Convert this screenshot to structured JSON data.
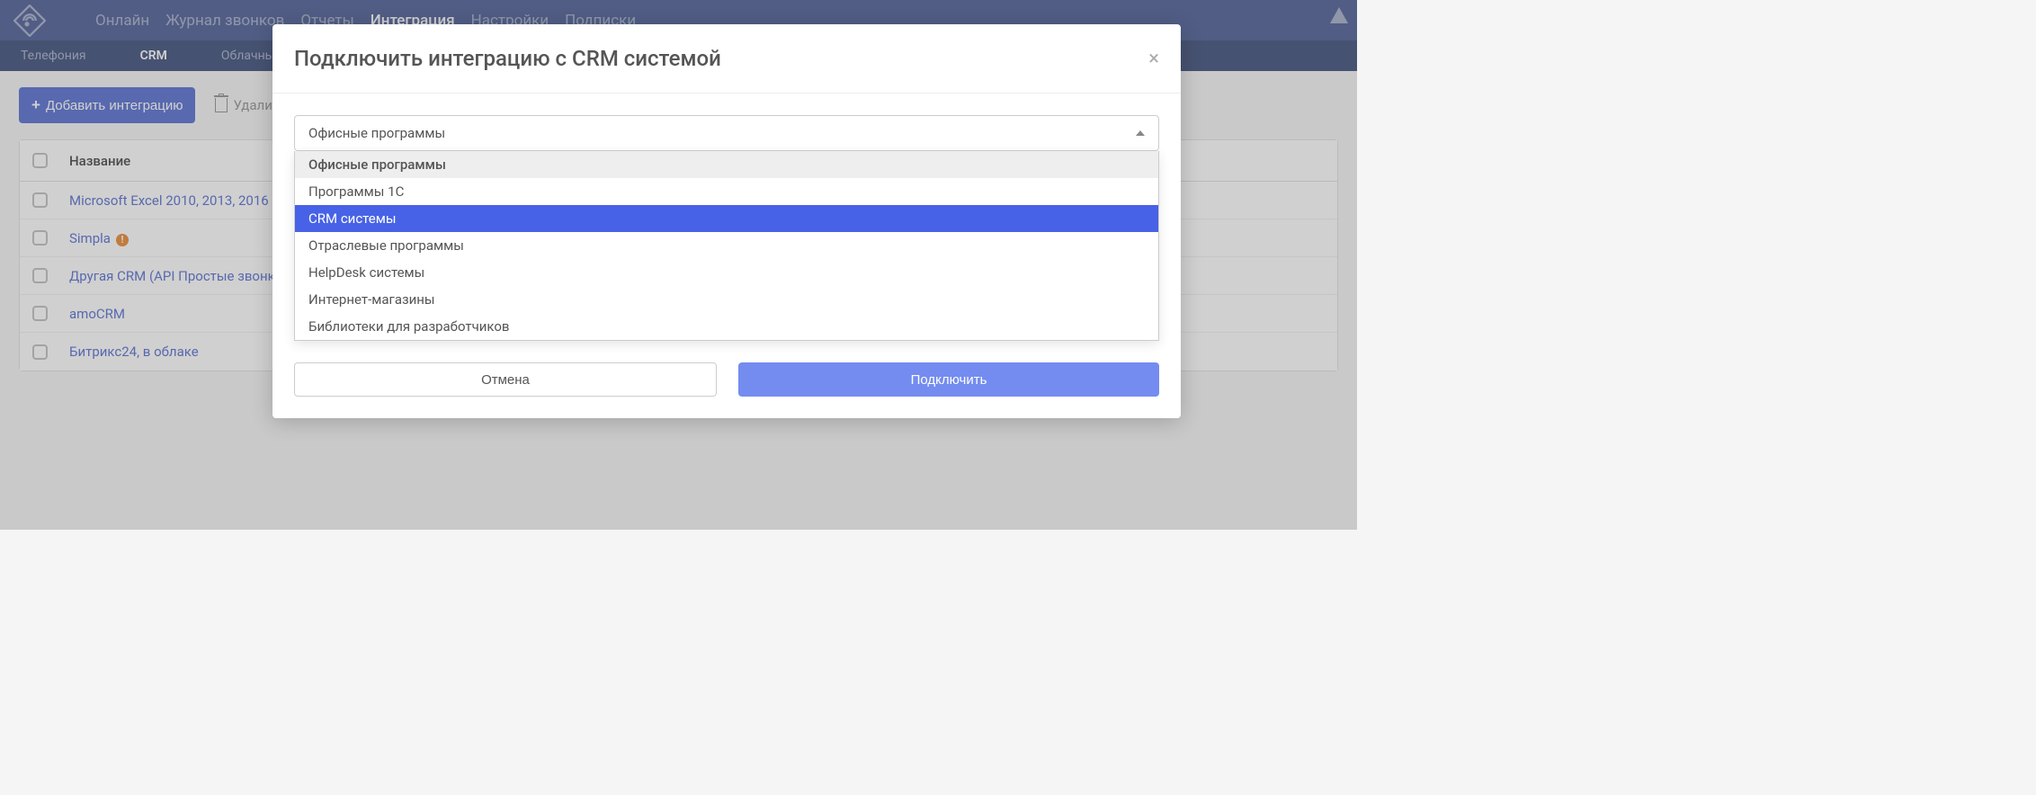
{
  "topnav": {
    "items": [
      "Онлайн",
      "Журнал звонков",
      "Отчеты",
      "Интеграция",
      "Настройки",
      "Подписки"
    ],
    "active_index": 3
  },
  "subnav": {
    "items": [
      "Телефония",
      "CRM",
      "Облачные хран"
    ],
    "active_index": 1
  },
  "toolbar": {
    "add_label": "Добавить интеграцию",
    "delete_label": "Удалить"
  },
  "table": {
    "header_name": "Название",
    "rows": [
      {
        "name": "Microsoft Excel 2010, 2013, 2016",
        "warn": true
      },
      {
        "name": "Simpla",
        "warn": true
      },
      {
        "name": "Другая CRM (API Простые звонки)",
        "warn": false
      },
      {
        "name": "amoCRM",
        "warn": false
      },
      {
        "name": "Битрикс24, в облаке",
        "warn": false
      }
    ]
  },
  "modal": {
    "title": "Подключить интеграцию с CRM системой",
    "select_label": "Офисные программы",
    "options": [
      {
        "label": "Офисные программы",
        "state": "current"
      },
      {
        "label": "Программы 1С",
        "state": ""
      },
      {
        "label": "CRM системы",
        "state": "highlighted"
      },
      {
        "label": "Отраслевые программы",
        "state": ""
      },
      {
        "label": "HelpDesk системы",
        "state": ""
      },
      {
        "label": "Интернет-магазины",
        "state": ""
      },
      {
        "label": "Библиотеки для разработчиков",
        "state": ""
      }
    ],
    "cancel_label": "Отмена",
    "connect_label": "Подключить"
  }
}
